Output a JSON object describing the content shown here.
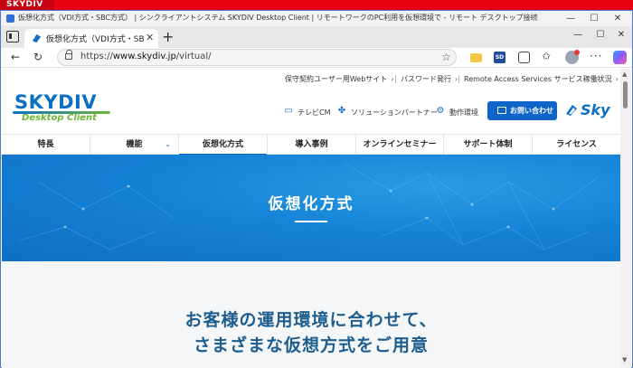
{
  "outer": {
    "brand": "SKYDIV"
  },
  "window": {
    "title": "仮想化方式（VDI方式・SBC方式） | シンクライアントシステム SKYDIV Desktop Client | リモートワークのPC利用を仮想環境で - リモート デスクトップ接続",
    "controls": {
      "minimize": "—",
      "maximize": "☐",
      "close": "✕"
    }
  },
  "tabs": [
    {
      "label": "仮想化方式（VDI方式・SBC方式",
      "close": "✕"
    }
  ],
  "tabstrip": {
    "new_tab": "+",
    "minimize": "—",
    "maximize": "☐",
    "close": "✕"
  },
  "address_bar": {
    "url_prefix": "https://",
    "url_host": "www.skydiv.jp",
    "url_path": "/virtual/",
    "star": "☆"
  },
  "toolbar_icons": {
    "back": "←",
    "refresh": "↻",
    "favorites": "✩",
    "more": "···",
    "sd_label": "SD"
  },
  "site": {
    "util_links": [
      {
        "label": "保守契約ユーザー用Webサイト",
        "chev": "›"
      },
      {
        "label": "パスワード発行",
        "chev": "›"
      },
      {
        "label": "Remote Access Services サービス稼働状況",
        "chev": "›"
      }
    ],
    "logo": {
      "main": "SKYDIV",
      "sub": "Desktop Client"
    },
    "header_links": [
      {
        "label": "テレビCM",
        "icon": "tv-icon",
        "glyph": "▭"
      },
      {
        "label": "ソリューションパートナー",
        "icon": "handshake-icon",
        "glyph": "✤"
      },
      {
        "label": "動作環境",
        "icon": "gear-icon",
        "glyph": "⚙"
      }
    ],
    "contact_button": "お問い合わせ",
    "sky_brand": "Sky",
    "nav": [
      {
        "label": "特長",
        "has_dropdown": false
      },
      {
        "label": "機能",
        "has_dropdown": true,
        "chev": "⌄"
      },
      {
        "label": "仮想化方式",
        "has_dropdown": false
      },
      {
        "label": "導入事例",
        "has_dropdown": false
      },
      {
        "label": "オンラインセミナー",
        "has_dropdown": false
      },
      {
        "label": "サポート体制",
        "has_dropdown": false
      },
      {
        "label": "ライセンス",
        "has_dropdown": false
      }
    ],
    "hero_title": "仮想化方式",
    "lead_lines": [
      "お客様の運用環境に合わせて、",
      "さまざまな仮想方式をご用意"
    ]
  },
  "colors": {
    "accent": "#0e64c8",
    "brand_red": "#e60012",
    "logo_green": "#6fb63a",
    "heading_blue": "#1d5d8e"
  }
}
